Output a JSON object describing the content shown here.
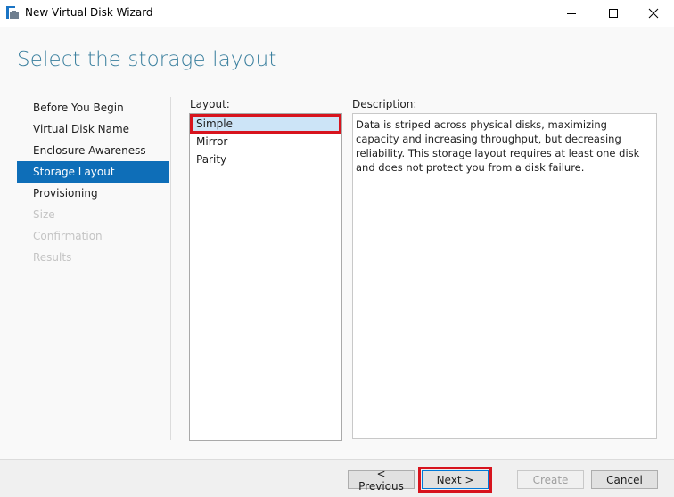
{
  "window": {
    "title": "New Virtual Disk Wizard",
    "controls": {
      "minimize": "—",
      "maximize": "☐",
      "close": "✕"
    }
  },
  "page": {
    "heading": "Select the storage layout"
  },
  "nav": {
    "items": [
      {
        "label": "Before You Begin",
        "state": "normal"
      },
      {
        "label": "Virtual Disk Name",
        "state": "normal"
      },
      {
        "label": "Enclosure Awareness",
        "state": "normal"
      },
      {
        "label": "Storage Layout",
        "state": "active"
      },
      {
        "label": "Provisioning",
        "state": "normal"
      },
      {
        "label": "Size",
        "state": "disabled"
      },
      {
        "label": "Confirmation",
        "state": "disabled"
      },
      {
        "label": "Results",
        "state": "disabled"
      }
    ]
  },
  "layout": {
    "label": "Layout:",
    "options": [
      {
        "label": "Simple",
        "selected": true
      },
      {
        "label": "Mirror",
        "selected": false
      },
      {
        "label": "Parity",
        "selected": false
      }
    ]
  },
  "description": {
    "label": "Description:",
    "text": "Data is striped across physical disks, maximizing capacity and increasing throughput, but decreasing reliability. This storage layout requires at least one disk and does not protect you from a disk failure."
  },
  "buttons": {
    "previous": "< Previous",
    "next": "Next >",
    "create": "Create",
    "cancel": "Cancel"
  },
  "colors": {
    "accent": "#0e6eb8",
    "heading": "#3a7f9e",
    "highlight": "#d7141e",
    "selection": "#cce4f7"
  }
}
